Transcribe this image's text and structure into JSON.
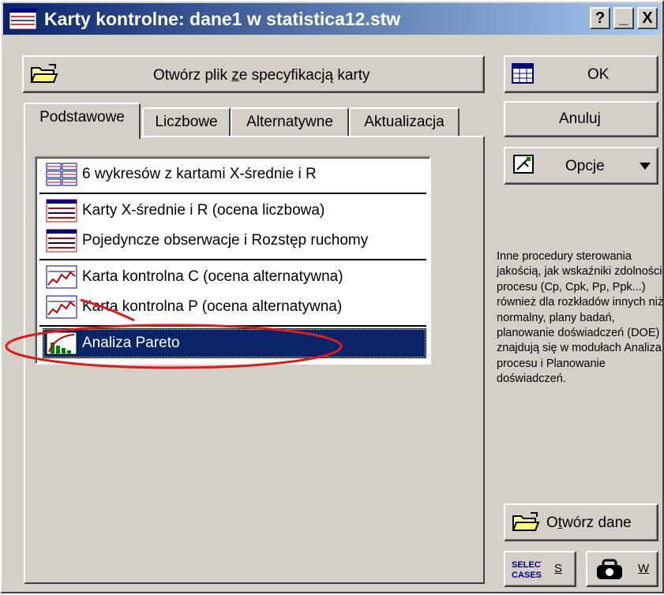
{
  "window": {
    "title": "Karty kontrolne: dane1 w statistica12.stw",
    "controls": {
      "help": "?",
      "minimize": "_",
      "close": "X"
    }
  },
  "open_spec_button": {
    "label_pre": "Otwórz plik ",
    "label_mnemonic": "z",
    "label_post": "e specyfikacją karty"
  },
  "tabs": [
    {
      "label": "Podstawowe"
    },
    {
      "label": "Liczbowe"
    },
    {
      "label": "Alternatywne"
    },
    {
      "label": "Aktualizacja"
    }
  ],
  "list": {
    "items": [
      {
        "label": "6 wykresów z kartami X-średnie i R",
        "icon": "six-charts-icon"
      },
      {
        "label": "Karty X-średnie i R (ocena liczbowa)",
        "icon": "control-chart-icon"
      },
      {
        "label": "Pojedyncze obserwacje i Rozstęp ruchomy",
        "icon": "control-chart-icon"
      },
      {
        "label": "Karta kontrolna C (ocena alternatywna)",
        "icon": "attribute-chart-icon"
      },
      {
        "label": "Karta kontrolna P (ocena alternatywna)",
        "icon": "attribute-chart-icon"
      },
      {
        "label": "Analiza Pareto",
        "icon": "pareto-chart-icon",
        "selected": true
      }
    ]
  },
  "buttons": {
    "ok": "OK",
    "cancel": "Anuluj",
    "options": "Opcje",
    "open_data_pre": "O",
    "open_data_mnemonic": "t",
    "open_data_post": "wórz dane",
    "select_cases_icon_line1": "SELECT",
    "select_cases_icon_line2": "CASES",
    "select_cases_key": "S",
    "weights_key": "W"
  },
  "info_text": "Inne procedury sterowania jakością, jak wskaźniki zdolności procesu (Cp, Cpk, Pp, Ppk...) również dla rozkładów innych niż normalny, plany badań, planowanie doświadczeń (DOE) znajdują się w modułach Analiza procesu i Planowanie doświadczeń.",
  "colors": {
    "titlebar_start": "#0a246a",
    "titlebar_end": "#a6caf0",
    "face": "#d4d0c8",
    "selection": "#0a246a",
    "annotation": "#e0181c"
  }
}
